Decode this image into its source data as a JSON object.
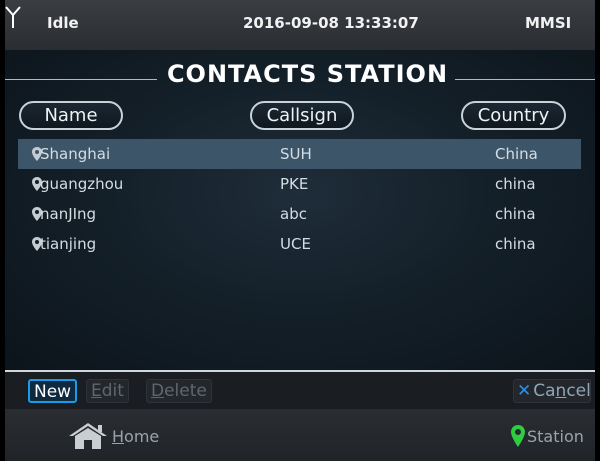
{
  "status": {
    "state": "Idle",
    "datetime": "2016-09-08 13:33:07",
    "mmsi": "MMSI"
  },
  "title": "CONTACTS STATION",
  "columns": {
    "name": "Name",
    "callsign": "Callsign",
    "country": "Country"
  },
  "contacts": [
    {
      "name": "Shanghai",
      "callsign": "SUH",
      "country": "China",
      "selected": true
    },
    {
      "name": "guangzhou",
      "callsign": "PKE",
      "country": "china",
      "selected": false
    },
    {
      "name": "nanJIng",
      "callsign": "abc",
      "country": "china",
      "selected": false
    },
    {
      "name": "tianjing",
      "callsign": "UCE",
      "country": "china",
      "selected": false
    }
  ],
  "actions": {
    "new": {
      "label": "New",
      "enabled": true
    },
    "edit": {
      "first": "E",
      "rest": "dit",
      "enabled": false
    },
    "delete": {
      "first": "D",
      "rest": "elete",
      "enabled": false
    },
    "cancel": {
      "first": "Ca",
      "mid": "n",
      "rest": "cel",
      "icon": "close-x-icon"
    }
  },
  "nav": {
    "home": {
      "first": "H",
      "rest": "ome",
      "icon": "home-icon"
    },
    "station": {
      "label": "Station",
      "icon": "map-pin-icon",
      "color": "#2ecc40"
    }
  },
  "colors": {
    "accent": "#1a9be6",
    "selected_row": "#3d5568"
  }
}
